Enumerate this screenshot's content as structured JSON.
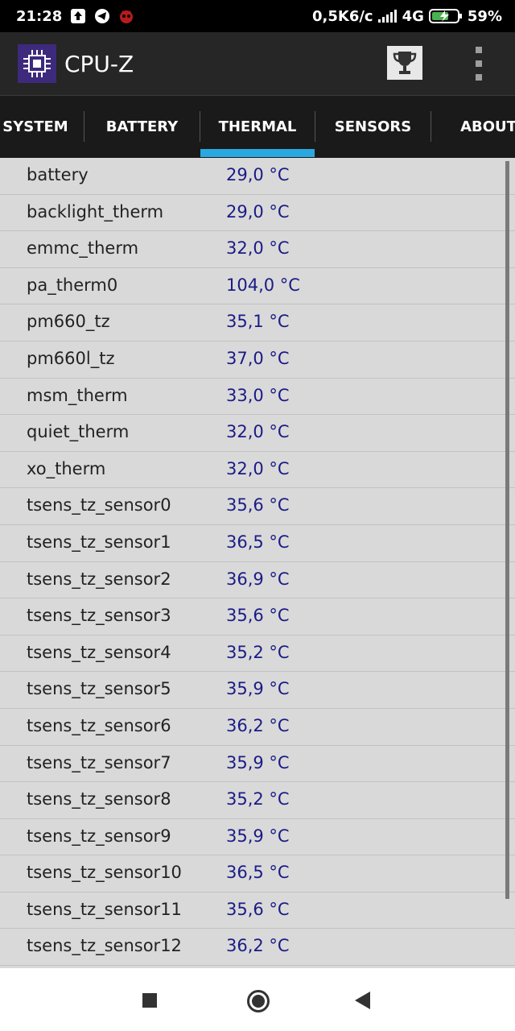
{
  "status_bar": {
    "time": "21:28",
    "network_speed": "0,5K6/c",
    "network_type": "4G",
    "battery": "59%",
    "left_icons": [
      "upload-icon",
      "telegram-icon",
      "game-icon"
    ],
    "right_icons": [
      "signal-icon",
      "battery-charging-icon"
    ]
  },
  "app_bar": {
    "title": "CPU-Z",
    "logo_icon": "cpu-chip-icon",
    "actions": [
      "trophy-icon",
      "overflow-menu-icon"
    ]
  },
  "tabs": [
    {
      "label": "SYSTEM",
      "active": false
    },
    {
      "label": "BATTERY",
      "active": false
    },
    {
      "label": "THERMAL",
      "active": true
    },
    {
      "label": "SENSORS",
      "active": false
    },
    {
      "label": "ABOUT",
      "active": false
    }
  ],
  "thermal": [
    {
      "name": "battery",
      "value": "29,0 °C"
    },
    {
      "name": "backlight_therm",
      "value": "29,0 °C"
    },
    {
      "name": "emmc_therm",
      "value": "32,0 °C"
    },
    {
      "name": "pa_therm0",
      "value": "104,0 °C"
    },
    {
      "name": "pm660_tz",
      "value": "35,1 °C"
    },
    {
      "name": "pm660l_tz",
      "value": "37,0 °C"
    },
    {
      "name": "msm_therm",
      "value": "33,0 °C"
    },
    {
      "name": "quiet_therm",
      "value": "32,0 °C"
    },
    {
      "name": "xo_therm",
      "value": "32,0 °C"
    },
    {
      "name": "tsens_tz_sensor0",
      "value": "35,6 °C"
    },
    {
      "name": "tsens_tz_sensor1",
      "value": "36,5 °C"
    },
    {
      "name": "tsens_tz_sensor2",
      "value": "36,9 °C"
    },
    {
      "name": "tsens_tz_sensor3",
      "value": "35,6 °C"
    },
    {
      "name": "tsens_tz_sensor4",
      "value": "35,2 °C"
    },
    {
      "name": "tsens_tz_sensor5",
      "value": "35,9 °C"
    },
    {
      "name": "tsens_tz_sensor6",
      "value": "36,2 °C"
    },
    {
      "name": "tsens_tz_sensor7",
      "value": "35,9 °C"
    },
    {
      "name": "tsens_tz_sensor8",
      "value": "35,2 °C"
    },
    {
      "name": "tsens_tz_sensor9",
      "value": "35,9 °C"
    },
    {
      "name": "tsens_tz_sensor10",
      "value": "36,5 °C"
    },
    {
      "name": "tsens_tz_sensor11",
      "value": "35,6 °C"
    },
    {
      "name": "tsens_tz_sensor12",
      "value": "36,2 °C"
    }
  ],
  "nav_bar": [
    "recents-icon",
    "home-icon",
    "back-icon"
  ],
  "colors": {
    "accent": "#2aa8e0",
    "value_text": "#1b1b86",
    "list_background": "#d9d9d9",
    "app_bar": "#262626",
    "tab_bar": "#1a1a1a"
  }
}
